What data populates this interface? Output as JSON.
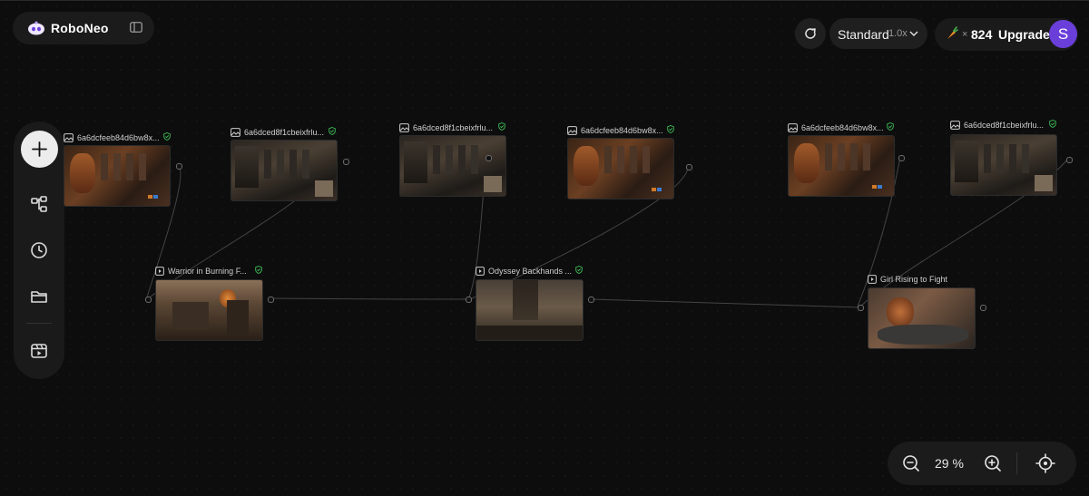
{
  "app": {
    "name": "RoboNeo"
  },
  "header": {
    "mode_label": "Standard",
    "mode_multiplier": "1.0x",
    "credits_prefix": "×",
    "credits": "824",
    "upgrade_label": "Upgrade",
    "avatar_initial": "S"
  },
  "toolbar": {
    "items": [
      "add",
      "workflow",
      "history",
      "folder",
      "media"
    ]
  },
  "image_nodes": [
    {
      "title": "6a6dcfeeb84d6bw8x...",
      "verified": true
    },
    {
      "title": "6a6dced8f1cbeixfrlu...",
      "verified": true
    },
    {
      "title": "6a6dced8f1cbeixfrlu...",
      "verified": true
    },
    {
      "title": "6a6dcfeeb84d6bw8x...",
      "verified": true
    },
    {
      "title": "6a6dcfeeb84d6bw8x...",
      "verified": true
    },
    {
      "title": "6a6dced8f1cbeixfrlu...",
      "verified": true
    }
  ],
  "video_nodes": [
    {
      "title": "Warrior in Burning F...",
      "verified": true
    },
    {
      "title": "Odyssey Backhands ...",
      "verified": true
    },
    {
      "title": "Girl Rising to Fight",
      "verified": false
    }
  ],
  "zoom": {
    "value": "29 %"
  },
  "colors": {
    "accent": "#6a3fd9",
    "verified": "#3fbf5a",
    "canvas": "#0d0d0d"
  }
}
